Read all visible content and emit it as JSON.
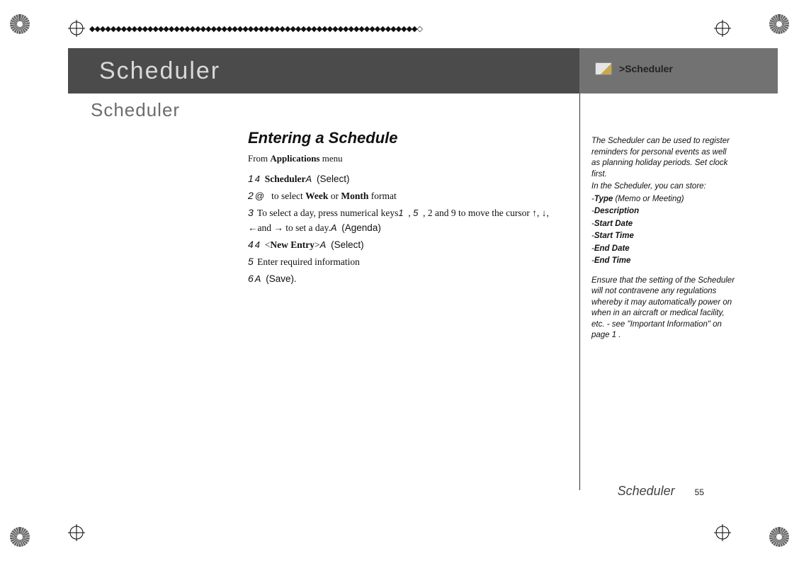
{
  "header": {
    "title": "Scheduler",
    "breadcrumb_prefix": "> ",
    "breadcrumb": "Scheduler"
  },
  "subtitle": "Scheduler",
  "section_heading": "Entering a Schedule",
  "from_line_prefix": "From ",
  "from_line_menu": "Applications",
  "from_line_suffix": " menu",
  "steps": {
    "s1_num": "1",
    "s1_a": "4",
    "s1_label": "Scheduler",
    "s1_b": "A",
    "s1_soft": "(Select)",
    "s2_num": "2",
    "s2_a": "@",
    "s2_text1": " to select ",
    "s2_week": "Week",
    "s2_or": " or ",
    "s2_month": "Month",
    "s2_text2": " format",
    "s3_num": "3",
    "s3_text1": " To select a day, press numerical keys",
    "s3_k1": "1",
    "s3_c1": ", ",
    "s3_k5": "5",
    "s3_text2": ", 2 and 9 to move the cursor ↑, ↓, ←and → to set a day.",
    "s3_b": "A",
    "s3_soft": "(Agenda)",
    "s4_num": "4",
    "s4_a": "4",
    "s4_lt": "<",
    "s4_label": "New Entry",
    "s4_gt": ">",
    "s4_b": "A",
    "s4_soft": "(Select)",
    "s5_num": "5",
    "s5_text": " Enter required information",
    "s6_num": "6",
    "s6_a": "A",
    "s6_soft": "(Save)",
    "s6_dot": "."
  },
  "side": {
    "p1": "The Scheduler can be used to register reminders for personal events as well as planning holiday periods. Set clock first.",
    "p2": "In the Scheduler, you can store:",
    "type_label": "Type",
    "type_suffix": " (Memo or Meeting)",
    "desc": "Description",
    "sdate": "Start Date",
    "stime": "Start Time",
    "edate": "End Date",
    "etime": "End Time",
    "p3": "Ensure that the setting of the Scheduler will not contravene any regulations whereby it may automatically power on when in an aircraft or medical facility, etc. - see \"Important Information\" on page 1 ."
  },
  "footer": {
    "title": "Scheduler",
    "page": "55"
  },
  "decor": "◆◆◆◆◆◆◆◆◆◆◆◆◆◆◆◆◆◆◆◆◆◆◆◆◆◆◆◆◆◆◆◆◆◆◆◆◆◆◆◆◆◆◆◆◆◆◆◆◆◆◆◆◆◆◆◆◆◆◆◆◆◆◇"
}
